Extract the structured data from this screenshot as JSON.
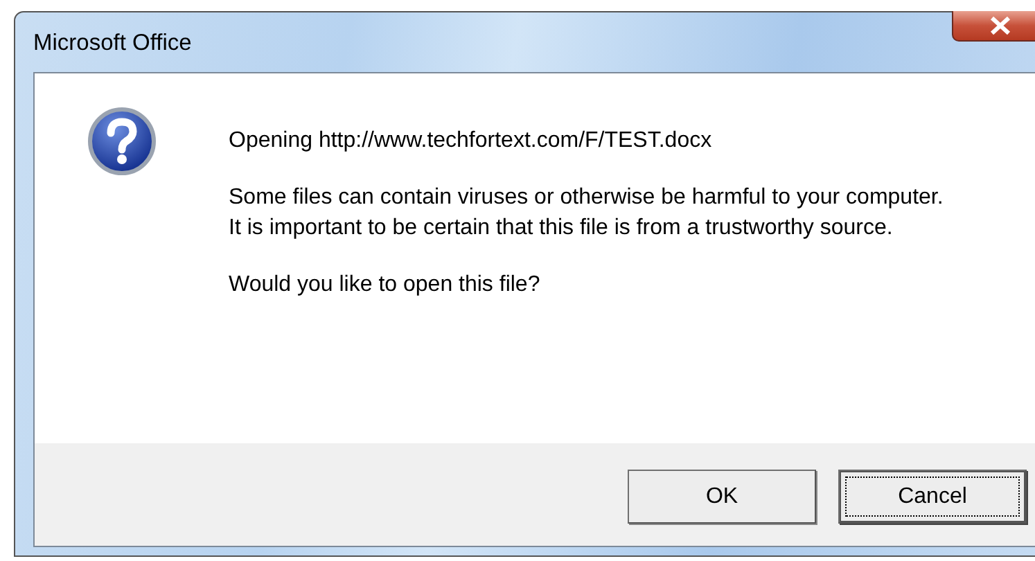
{
  "window": {
    "title": "Microsoft Office"
  },
  "message": {
    "heading": "Opening http://www.techfortext.com/F/TEST.docx",
    "paragraphs": [
      "Some files can contain viruses or otherwise be harmful to your computer.\nIt is important to be certain that this file is from a trustworthy source.",
      "Would you like to open this file?"
    ]
  },
  "buttons": [
    {
      "label": "OK",
      "focused": false
    },
    {
      "label": "Cancel",
      "focused": true
    }
  ]
}
